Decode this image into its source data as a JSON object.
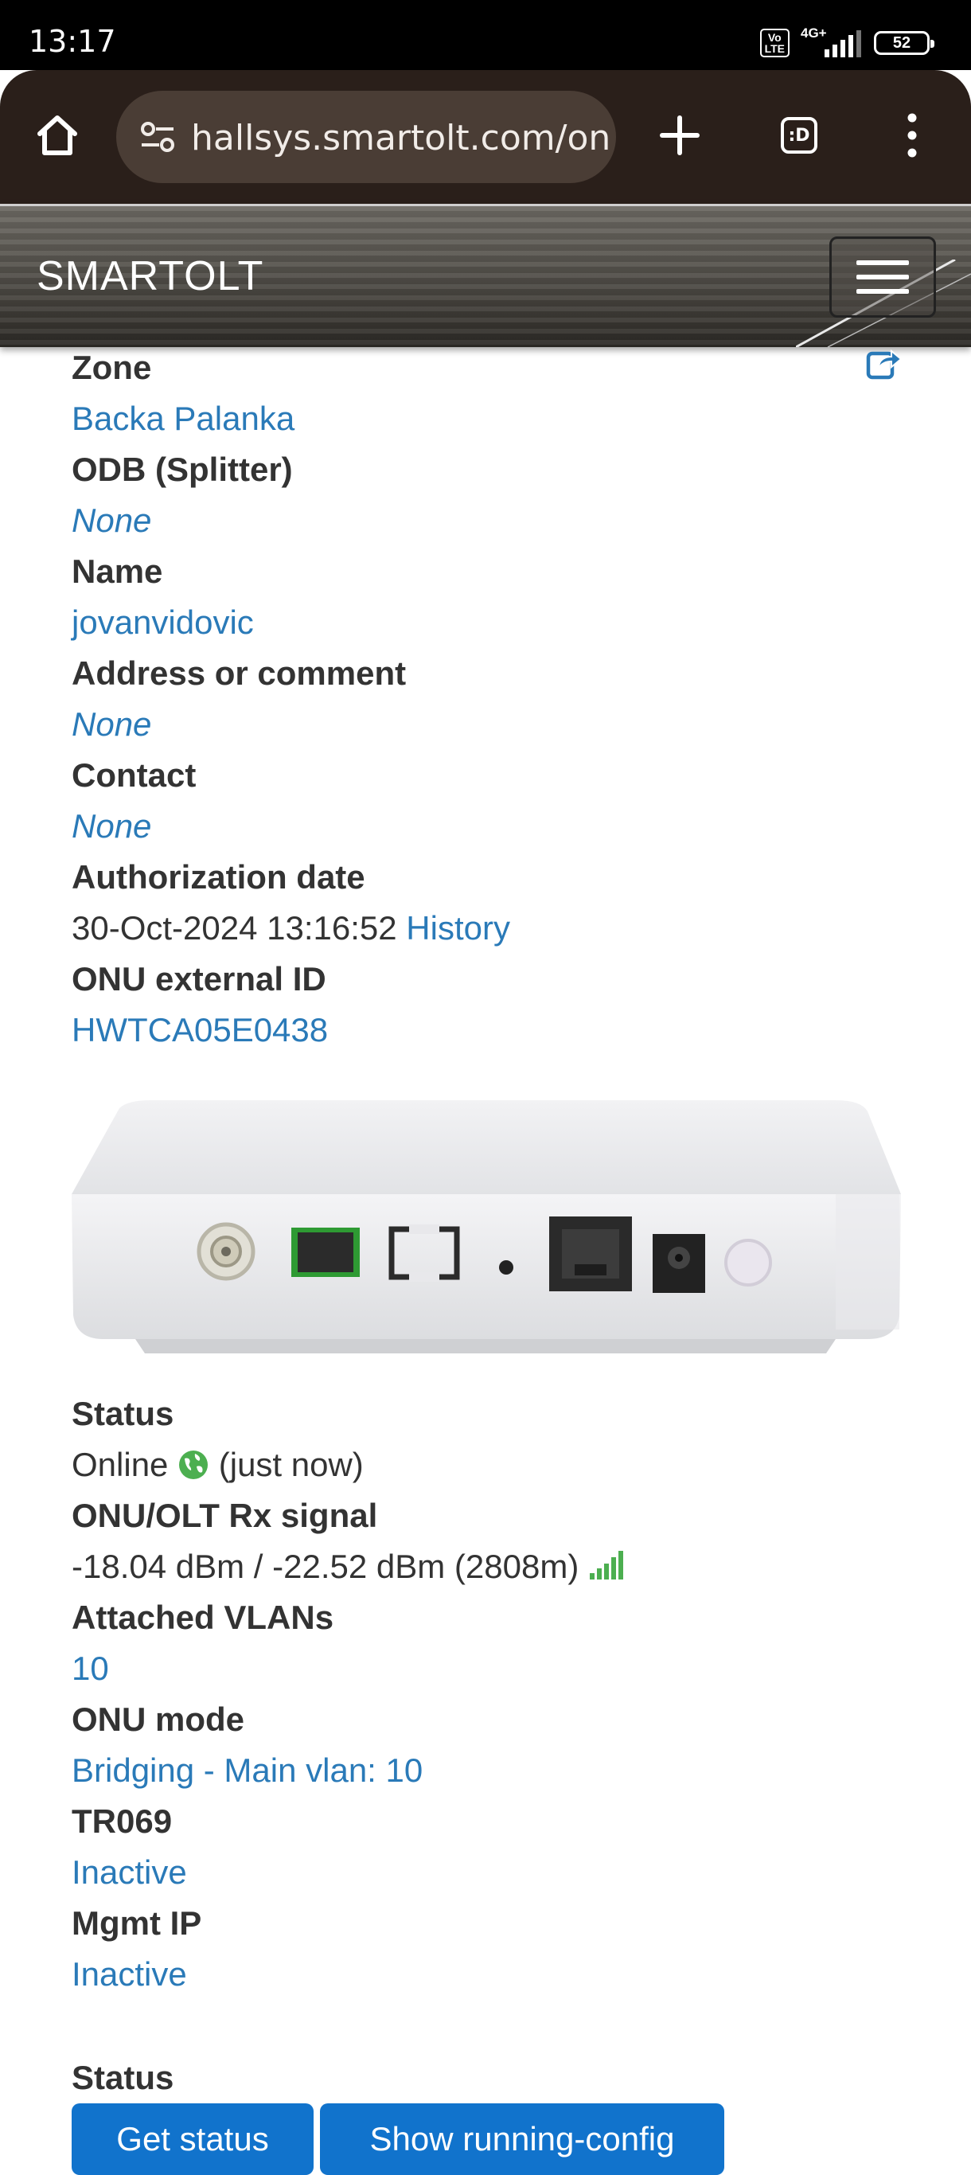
{
  "status_bar": {
    "time": "13:17",
    "volte": "Vo\nLTE",
    "network": "4G+",
    "battery": "52"
  },
  "browser": {
    "url": "hallsys.smartolt.com/on",
    "tabs_label": ":D"
  },
  "header": {
    "brand": "SMARTOLT"
  },
  "details": [
    {
      "label": "Zone",
      "value": "Backa Palanka"
    },
    {
      "label": "ODB (Splitter)",
      "value": "None"
    },
    {
      "label": "Name",
      "value": "jovanvidovic"
    },
    {
      "label": "Address or comment",
      "value": "None"
    },
    {
      "label": "Contact",
      "value": "None"
    },
    {
      "label": "Authorization date",
      "value": "30-Oct-2024 13:16:52",
      "link": "History"
    },
    {
      "label": "ONU external ID",
      "value": "HWTCA05E0438"
    }
  ],
  "status_details": [
    {
      "label": "Status",
      "value": "Online",
      "suffix": "(just now)"
    },
    {
      "label": "ONU/OLT Rx signal",
      "value": "-18.04 dBm / -22.52 dBm (2808m)"
    },
    {
      "label": "Attached VLANs",
      "value": "10"
    },
    {
      "label": "ONU mode",
      "value": "Bridging - Main vlan: 10"
    },
    {
      "label": "TR069",
      "value": "Inactive"
    },
    {
      "label": "Mgmt IP",
      "value": "Inactive"
    }
  ],
  "actions": {
    "section_label": "Status",
    "get_status": "Get status",
    "show_running_config": "Show running-config"
  },
  "colors": {
    "link": "#2a7ab8",
    "button": "#1173cc",
    "online_green": "#4caf50"
  }
}
